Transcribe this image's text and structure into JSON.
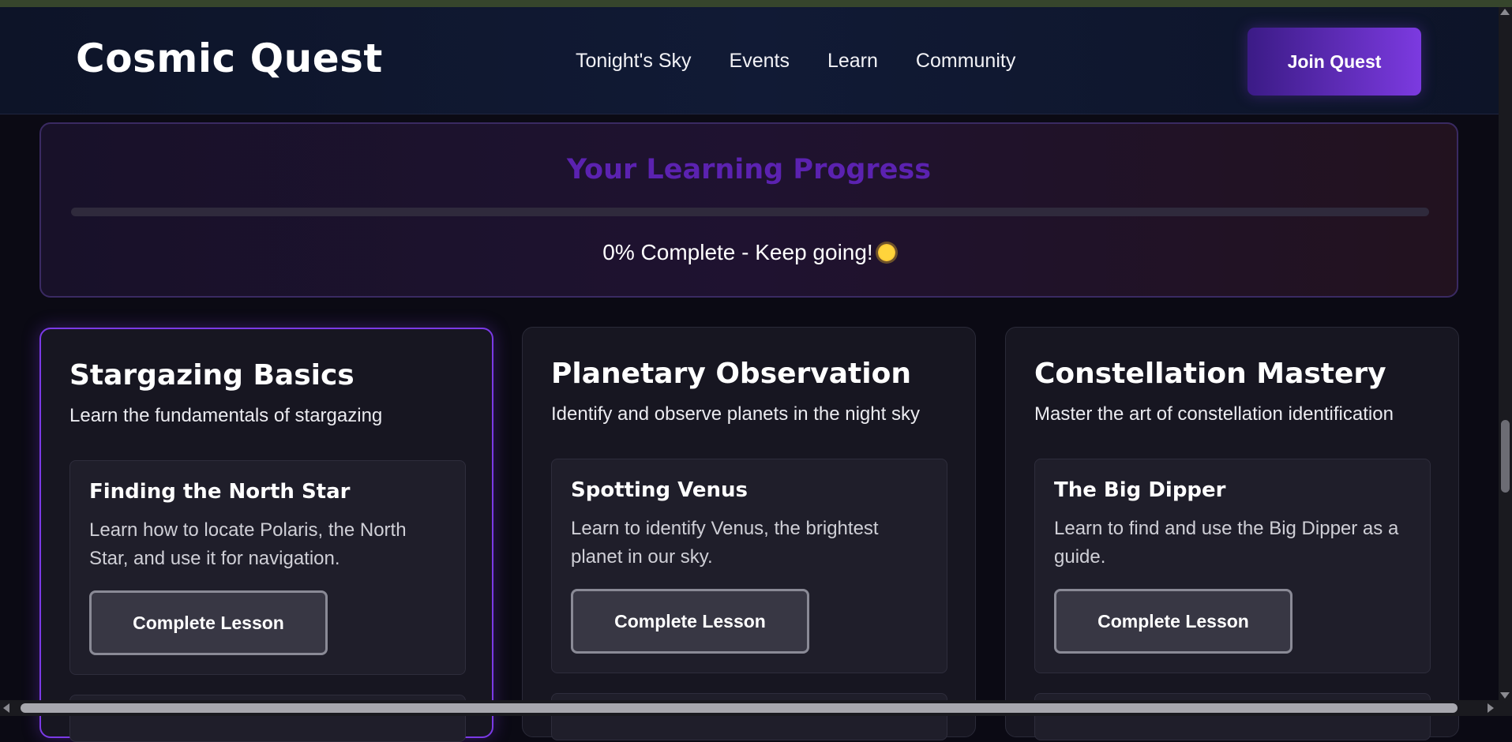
{
  "header": {
    "logo": "Cosmic Quest",
    "nav": [
      "Tonight's Sky",
      "Events",
      "Learn",
      "Community"
    ],
    "join_label": "Join Quest"
  },
  "progress": {
    "title": "Your Learning Progress",
    "fraction": 0,
    "status": "0% Complete - Keep going!",
    "status_icon": "sun-emoji-icon"
  },
  "cards": [
    {
      "title": "Stargazing Basics",
      "description": "Learn the fundamentals of stargazing",
      "lesson": {
        "title": "Finding the North Star",
        "text": "Learn how to locate Polaris, the North Star, and use it for navigation.",
        "button": "Complete Lesson"
      }
    },
    {
      "title": "Planetary Observation",
      "description": "Identify and observe planets in the night sky",
      "lesson": {
        "title": "Spotting Venus",
        "text": "Learn to identify Venus, the brightest planet in our sky.",
        "button": "Complete Lesson"
      }
    },
    {
      "title": "Constellation Mastery",
      "description": "Master the art of constellation identification",
      "lesson": {
        "title": "The Big Dipper",
        "text": "Learn to find and use the Big Dipper as a guide.",
        "button": "Complete Lesson"
      }
    }
  ],
  "colors": {
    "accent": "#7c3ae0",
    "progress_title": "#5b22b0",
    "background": "#0b0a14"
  }
}
